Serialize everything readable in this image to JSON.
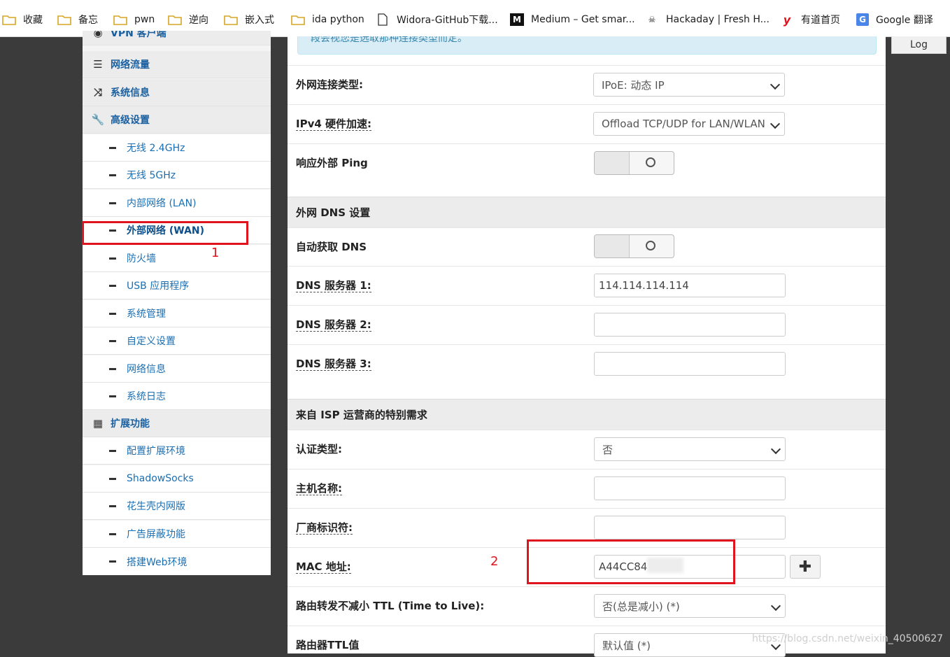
{
  "bookmarks": [
    {
      "label": "收藏",
      "type": "folder"
    },
    {
      "label": "备忘",
      "type": "folder"
    },
    {
      "label": "pwn",
      "type": "folder"
    },
    {
      "label": "逆向",
      "type": "folder"
    },
    {
      "label": "嵌入式",
      "type": "folder"
    },
    {
      "label": "ida python",
      "type": "folder"
    },
    {
      "label": "Widora-GitHub下载...",
      "type": "page"
    },
    {
      "label": "Medium – Get smar...",
      "type": "medium"
    },
    {
      "label": "Hackaday | Fresh H...",
      "type": "hackaday"
    },
    {
      "label": "有道首页",
      "type": "youdao"
    },
    {
      "label": "Google 翻译",
      "type": "gtranslate"
    }
  ],
  "top_right": {
    "log_label": "Log"
  },
  "sidebar": {
    "partial_top": "VPN 客户端",
    "items": [
      {
        "label": "网络流量",
        "icon": "list-icon",
        "level": "top"
      },
      {
        "label": "系统信息",
        "icon": "shuffle-icon",
        "level": "top"
      },
      {
        "label": "高级设置",
        "icon": "wrench-icon",
        "level": "top"
      },
      {
        "label": "无线 2.4GHz",
        "level": "sub"
      },
      {
        "label": "无线 5GHz",
        "level": "sub"
      },
      {
        "label": "内部网络 (LAN)",
        "level": "sub"
      },
      {
        "label": "外部网络 (WAN)",
        "level": "sub",
        "active": true
      },
      {
        "label": "防火墙",
        "level": "sub"
      },
      {
        "label": "USB 应用程序",
        "level": "sub"
      },
      {
        "label": "系统管理",
        "level": "sub"
      },
      {
        "label": "自定义设置",
        "level": "sub"
      },
      {
        "label": "网络信息",
        "level": "sub"
      },
      {
        "label": "系统日志",
        "level": "sub"
      },
      {
        "label": "扩展功能",
        "icon": "grid-icon",
        "level": "top"
      },
      {
        "label": "配置扩展环境",
        "level": "sub"
      },
      {
        "label": "ShadowSocks",
        "level": "sub"
      },
      {
        "label": "花生壳内网版",
        "level": "sub"
      },
      {
        "label": "广告屏蔽功能",
        "level": "sub"
      },
      {
        "label": "搭建Web环境",
        "level": "sub"
      }
    ]
  },
  "main": {
    "alert_text": "段会视您是选取那种连接类型而定。",
    "wan_type_label": "外网连接类型:",
    "wan_type_value": "IPoE: 动态 IP",
    "hw_accel_label": "IPv4 硬件加速:",
    "hw_accel_value": "Offload TCP/UDP for LAN/WLAN",
    "ping_label": "响应外部 Ping",
    "dns_section": "外网 DNS 设置",
    "auto_dns_label": "自动获取 DNS",
    "dns1_label": "DNS 服务器 1:",
    "dns1_value": "114.114.114.114",
    "dns2_label": "DNS 服务器 2:",
    "dns2_value": "",
    "dns3_label": "DNS 服务器 3:",
    "dns3_value": "",
    "isp_section": "来自 ISP 运营商的特别需求",
    "auth_label": "认证类型:",
    "auth_value": "否",
    "hostname_label": "主机名称:",
    "hostname_value": "",
    "vendor_label": "厂商标识符:",
    "vendor_value": "",
    "mac_label": "MAC 地址:",
    "mac_value": "A44CC84",
    "ttl_label": "路由转发不减小 TTL (Time to Live):",
    "ttl_value": "否(总是减小) (*)",
    "router_ttl_label": "路由器TTL值",
    "router_ttl_value": "默认值 (*)"
  },
  "annotations": {
    "one": "1",
    "two": "2"
  },
  "watermark": "https://blog.csdn.net/weixin_40500627",
  "colors": {
    "link": "#1a6fb3",
    "annotation": "#e0141e",
    "alert_bg": "#d9edf7"
  }
}
